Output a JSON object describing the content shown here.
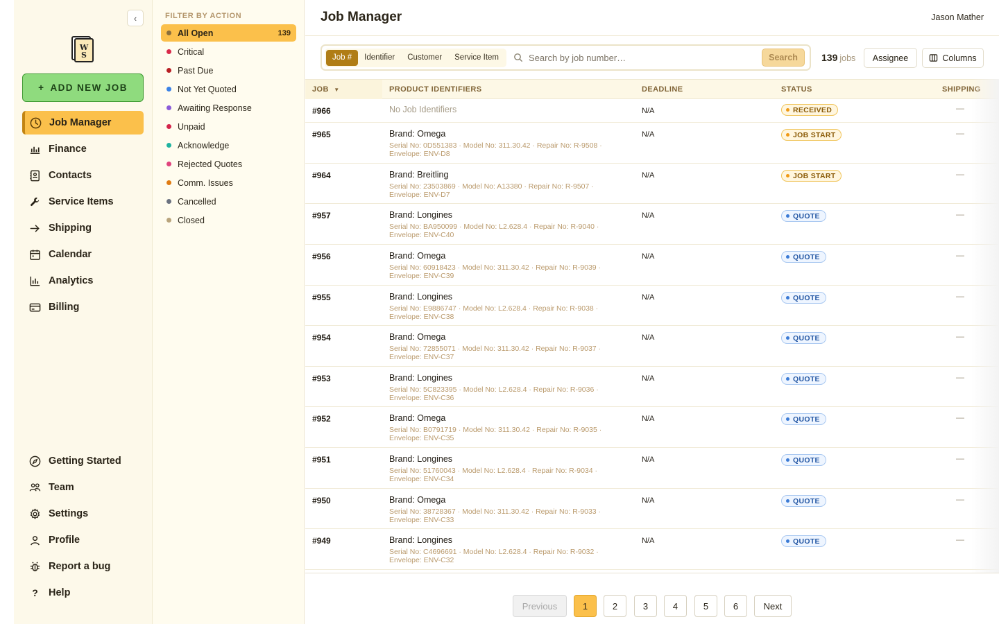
{
  "nav": {
    "add_job_label": "ADD NEW JOB",
    "logo_text": "WS",
    "items": [
      {
        "label": "Job Manager",
        "icon": "clock-icon"
      },
      {
        "label": "Finance",
        "icon": "bar-chart-icon"
      },
      {
        "label": "Contacts",
        "icon": "contacts-book-icon"
      },
      {
        "label": "Service Items",
        "icon": "wrench-icon"
      },
      {
        "label": "Shipping",
        "icon": "arrow-right-icon"
      },
      {
        "label": "Calendar",
        "icon": "calendar-icon"
      },
      {
        "label": "Analytics",
        "icon": "analytics-icon"
      },
      {
        "label": "Billing",
        "icon": "credit-card-icon"
      }
    ],
    "bottom_items": [
      {
        "label": "Getting Started",
        "icon": "compass-icon"
      },
      {
        "label": "Team",
        "icon": "team-icon"
      },
      {
        "label": "Settings",
        "icon": "gear-icon"
      },
      {
        "label": "Profile",
        "icon": "user-icon"
      },
      {
        "label": "Report a bug",
        "icon": "bug-icon"
      },
      {
        "label": "Help",
        "icon": "question-icon"
      }
    ]
  },
  "filters": {
    "heading": "FILTER BY ACTION",
    "items": [
      {
        "label": "All Open",
        "count": "139",
        "color": "#8a6e3c"
      },
      {
        "label": "Critical",
        "color": "#d92a4a"
      },
      {
        "label": "Past Due",
        "color": "#b81f24"
      },
      {
        "label": "Not Yet Quoted",
        "color": "#3b82e6"
      },
      {
        "label": "Awaiting Response",
        "color": "#8b5bd9"
      },
      {
        "label": "Unpaid",
        "color": "#d4244b"
      },
      {
        "label": "Acknowledge",
        "color": "#1fb3a0"
      },
      {
        "label": "Rejected Quotes",
        "color": "#e0437d"
      },
      {
        "label": "Comm. Issues",
        "color": "#e07b12"
      },
      {
        "label": "Cancelled",
        "color": "#6b7280"
      },
      {
        "label": "Closed",
        "color": "#b9a47c"
      }
    ]
  },
  "header": {
    "title": "Job Manager",
    "user": "Jason Mather"
  },
  "search": {
    "modes": [
      "Job #",
      "Identifier",
      "Customer",
      "Service Item"
    ],
    "active_mode": "Job #",
    "placeholder": "Search by job number…",
    "button_label": "Search"
  },
  "summary": {
    "count": "139",
    "unit": "jobs",
    "assignee_label": "Assignee",
    "columns_label": "Columns"
  },
  "table": {
    "columns": [
      "JOB",
      "PRODUCT IDENTIFIERS",
      "DEADLINE",
      "STATUS",
      "SHIPPING"
    ],
    "sort_indicator": "▼",
    "rows": [
      {
        "job": "#966",
        "brand": "No Job Identifiers",
        "meta": "",
        "deadline": "N/A",
        "status": "RECEIVED",
        "tone": "amber",
        "shipping": "—"
      },
      {
        "job": "#965",
        "brand": "Brand: Omega",
        "meta": "Serial No: 0D551383 · Model No: 311.30.42 · Repair No: R-9508 · Envelope: ENV-D8",
        "deadline": "N/A",
        "status": "JOB START",
        "tone": "amber",
        "shipping": "—"
      },
      {
        "job": "#964",
        "brand": "Brand: Breitling",
        "meta": "Serial No: 23503869 · Model No: A13380 · Repair No: R-9507 · Envelope: ENV-D7",
        "deadline": "N/A",
        "status": "JOB START",
        "tone": "amber",
        "shipping": "—"
      },
      {
        "job": "#957",
        "brand": "Brand: Longines",
        "meta": "Serial No: BA950099 · Model No: L2.628.4 · Repair No: R-9040 · Envelope: ENV-C40",
        "deadline": "N/A",
        "status": "QUOTE",
        "tone": "blue",
        "shipping": "—"
      },
      {
        "job": "#956",
        "brand": "Brand: Omega",
        "meta": "Serial No: 60918423 · Model No: 311.30.42 · Repair No: R-9039 · Envelope: ENV-C39",
        "deadline": "N/A",
        "status": "QUOTE",
        "tone": "blue",
        "shipping": "—"
      },
      {
        "job": "#955",
        "brand": "Brand: Longines",
        "meta": "Serial No: E9886747 · Model No: L2.628.4 · Repair No: R-9038 · Envelope: ENV-C38",
        "deadline": "N/A",
        "status": "QUOTE",
        "tone": "blue",
        "shipping": "—"
      },
      {
        "job": "#954",
        "brand": "Brand: Omega",
        "meta": "Serial No: 72855071 · Model No: 311.30.42 · Repair No: R-9037 · Envelope: ENV-C37",
        "deadline": "N/A",
        "status": "QUOTE",
        "tone": "blue",
        "shipping": "—"
      },
      {
        "job": "#953",
        "brand": "Brand: Longines",
        "meta": "Serial No: 5C823395 · Model No: L2.628.4 · Repair No: R-9036 · Envelope: ENV-C36",
        "deadline": "N/A",
        "status": "QUOTE",
        "tone": "blue",
        "shipping": "—"
      },
      {
        "job": "#952",
        "brand": "Brand: Omega",
        "meta": "Serial No: B0791719 · Model No: 311.30.42 · Repair No: R-9035 · Envelope: ENV-C35",
        "deadline": "N/A",
        "status": "QUOTE",
        "tone": "blue",
        "shipping": "—"
      },
      {
        "job": "#951",
        "brand": "Brand: Longines",
        "meta": "Serial No: 51760043 · Model No: L2.628.4 · Repair No: R-9034 · Envelope: ENV-C34",
        "deadline": "N/A",
        "status": "QUOTE",
        "tone": "blue",
        "shipping": "—"
      },
      {
        "job": "#950",
        "brand": "Brand: Omega",
        "meta": "Serial No: 38728367 · Model No: 311.30.42 · Repair No: R-9033 · Envelope: ENV-C33",
        "deadline": "N/A",
        "status": "QUOTE",
        "tone": "blue",
        "shipping": "—"
      },
      {
        "job": "#949",
        "brand": "Brand: Longines",
        "meta": "Serial No: C4696691 · Model No: L2.628.4 · Repair No: R-9032 · Envelope: ENV-C32",
        "deadline": "N/A",
        "status": "QUOTE",
        "tone": "blue",
        "shipping": "—"
      }
    ]
  },
  "pagination": {
    "previous_label": "Previous",
    "next_label": "Next",
    "pages": [
      "1",
      "2",
      "3",
      "4",
      "5",
      "6"
    ],
    "current": "1"
  }
}
